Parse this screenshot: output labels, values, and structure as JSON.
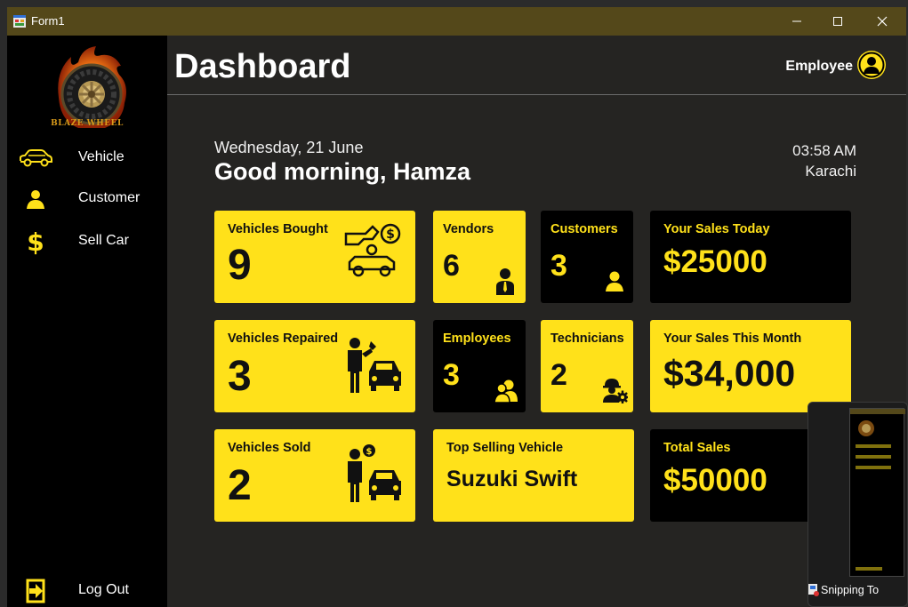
{
  "window": {
    "title": "Form1",
    "minimize": "—",
    "maximize": "□",
    "close": "✕"
  },
  "sidebar": {
    "brand": "BLAZE WHEEL",
    "items": [
      {
        "label": "Vehicle",
        "icon": "car-icon"
      },
      {
        "label": "Customer",
        "icon": "user-icon"
      },
      {
        "label": "Sell Car",
        "icon": "dollar-icon"
      }
    ],
    "logout": {
      "label": "Log Out",
      "icon": "logout-icon"
    }
  },
  "header": {
    "title": "Dashboard",
    "role": "Employee",
    "avatar_icon": "user-circle-icon"
  },
  "greeting": {
    "date": "Wednesday, 21 June",
    "message": "Good morning, Hamza",
    "time": "03:58 AM",
    "city": "Karachi"
  },
  "cards": {
    "vehicles_bought": {
      "title": "Vehicles Bought",
      "value": "9",
      "icon": "car-dollar-icon"
    },
    "vendors": {
      "title": "Vendors",
      "value": "6",
      "icon": "businessman-icon"
    },
    "customers": {
      "title": "Customers",
      "value": "3",
      "icon": "user-icon"
    },
    "sales_today": {
      "title": "Your Sales Today",
      "value": "$25000"
    },
    "vehicles_repaired": {
      "title": "Vehicles Repaired",
      "value": "3",
      "icon": "mechanic-car-icon"
    },
    "employees": {
      "title": "Employees",
      "value": "3",
      "icon": "users-icon"
    },
    "technicians": {
      "title": "Technicians",
      "value": "2",
      "icon": "technician-gear-icon"
    },
    "sales_month": {
      "title": "Your Sales This Month",
      "value": "$34,000"
    },
    "vehicles_sold": {
      "title": "Vehicles Sold",
      "value": "2",
      "icon": "seller-car-icon"
    },
    "top_vehicle": {
      "title": "Top Selling Vehicle",
      "value": "Suzuki Swift"
    },
    "total_sales": {
      "title": "Total Sales",
      "value": "$50000"
    }
  },
  "taskbar_preview": {
    "label": "Snipping To"
  },
  "colors": {
    "accent": "#ffe11a",
    "sidebar": "#000000",
    "background": "#252422",
    "titlebar": "#54481a",
    "brand": "#d89a1a"
  }
}
